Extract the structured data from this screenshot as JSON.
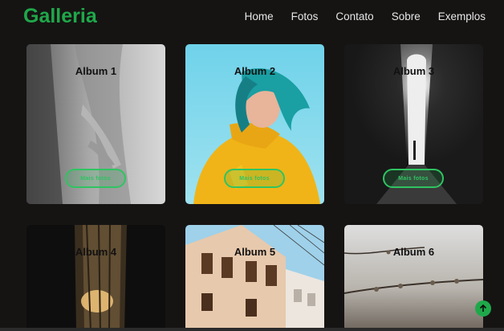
{
  "brand": {
    "name": "Galleria",
    "color": "#1fa84a"
  },
  "nav": {
    "items": [
      "Home",
      "Fotos",
      "Contato",
      "Sobre",
      "Exemplos"
    ]
  },
  "albums": [
    {
      "title": "Album 1",
      "button": "Mais fotos"
    },
    {
      "title": "Album 2",
      "button": "Mais fotos"
    },
    {
      "title": "Album 3",
      "button": "Mais fotos"
    },
    {
      "title": "Album 4"
    },
    {
      "title": "Album 5"
    },
    {
      "title": "Album 6"
    }
  ],
  "icons": {
    "scroll_top": "arrow-up-icon"
  }
}
